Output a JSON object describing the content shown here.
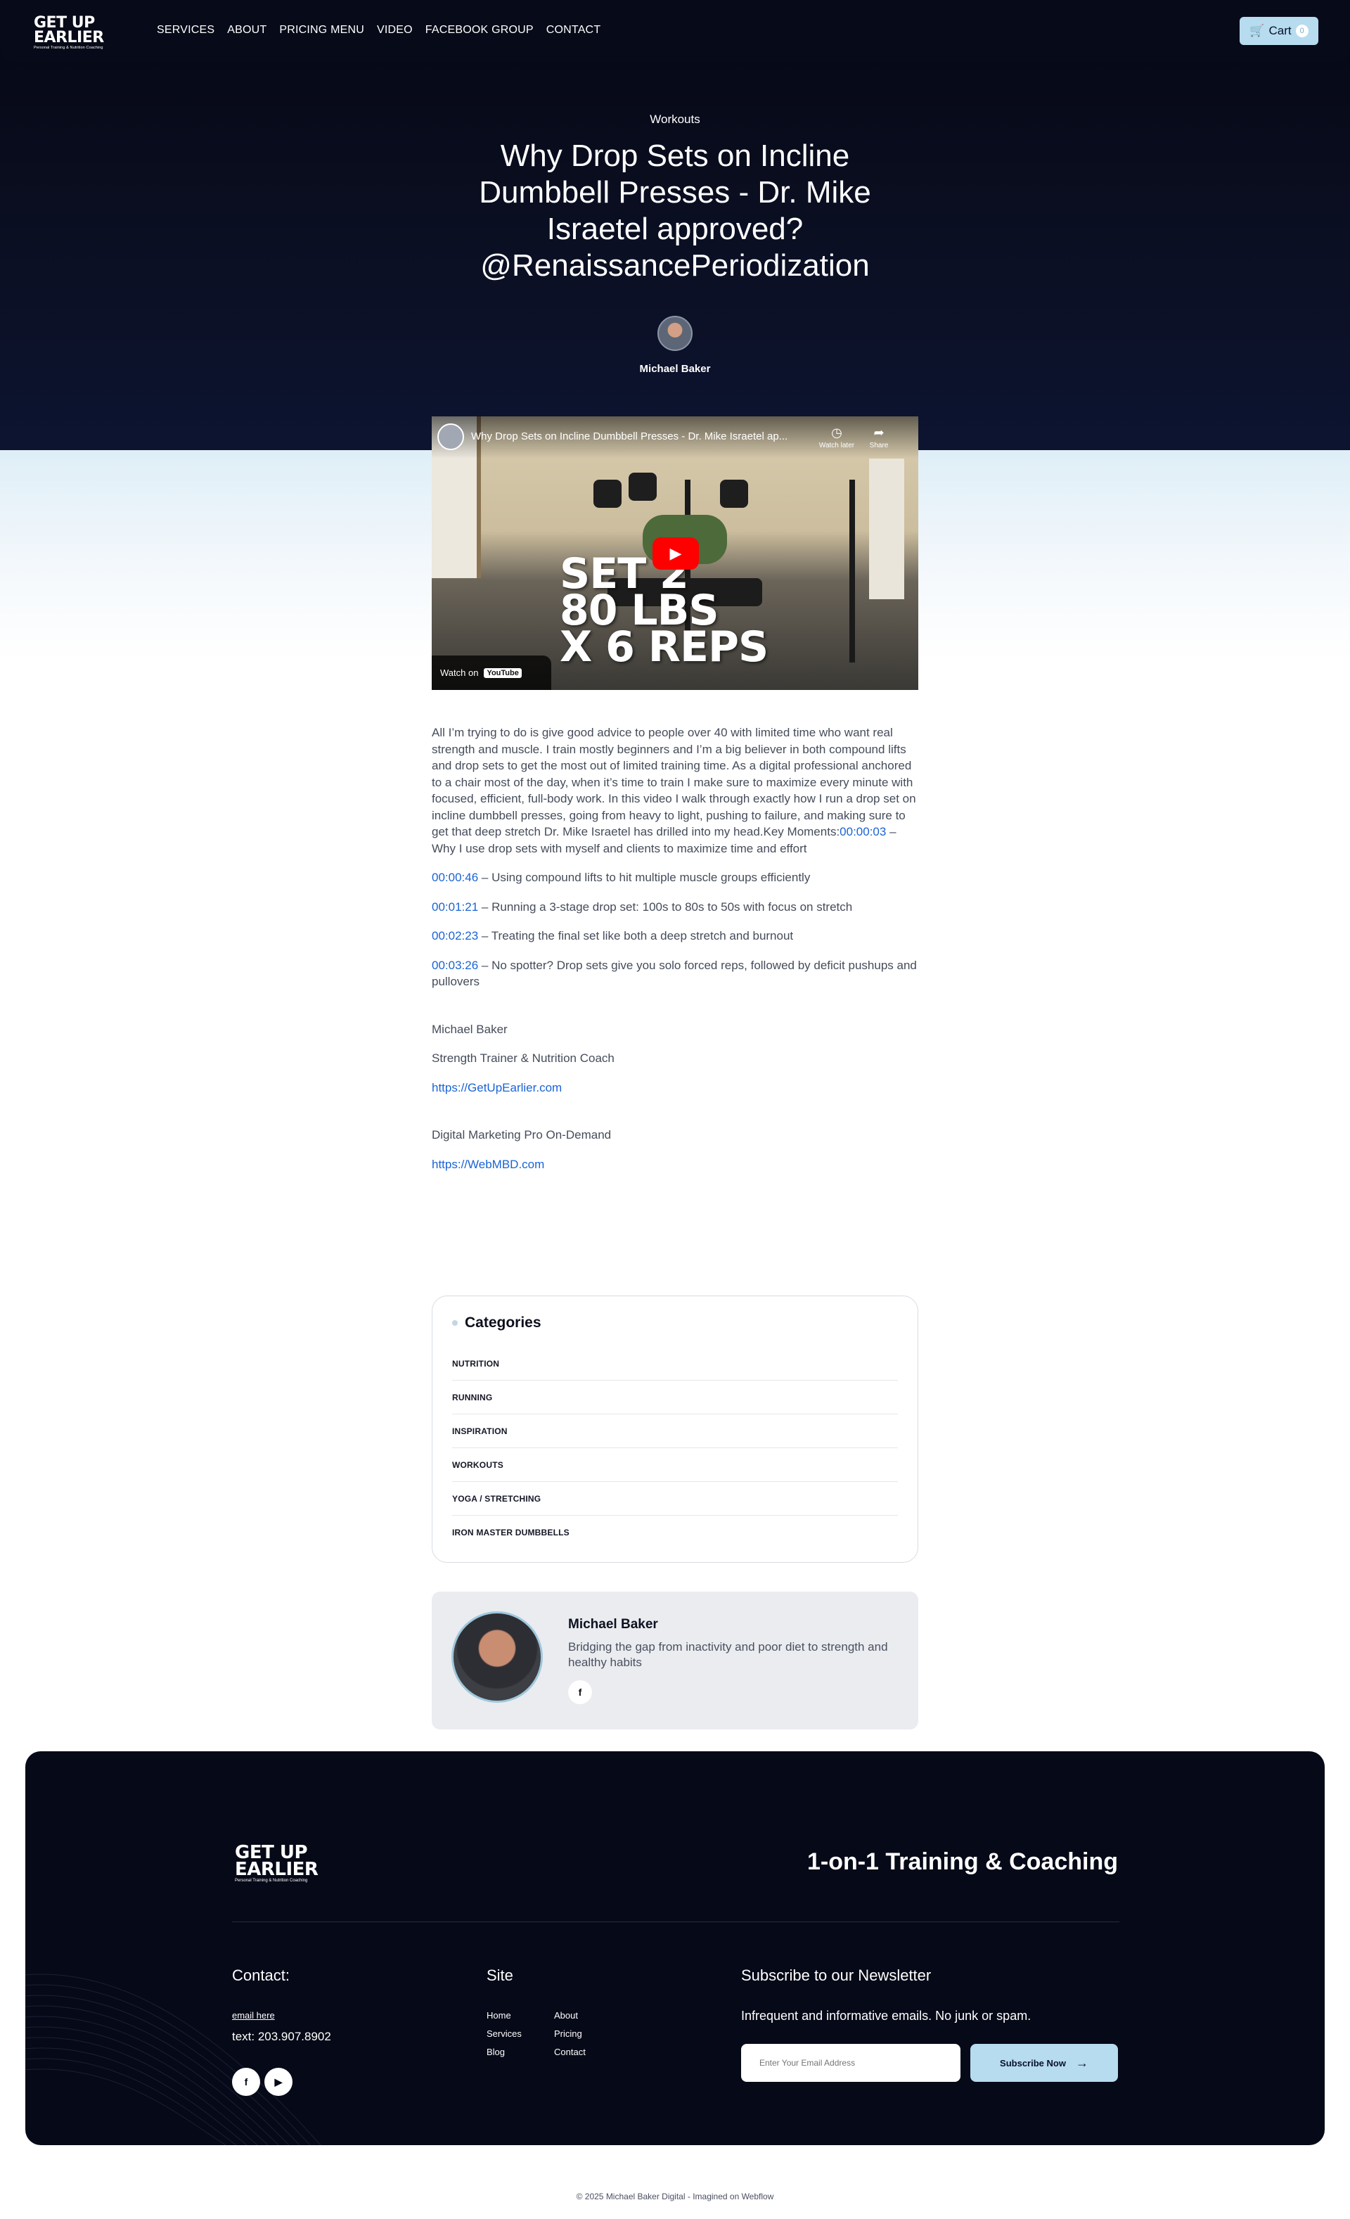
{
  "nav": {
    "logo_line1": "GET UP",
    "logo_line2": "EARLIER",
    "logo_tagline": "Personal Training & Nutrition Coaching",
    "links": [
      "SERVICES",
      "ABOUT",
      "PRICING MENU",
      "VIDEO",
      "FACEBOOK GROUP",
      "CONTACT"
    ],
    "cart_label": "Cart",
    "cart_count": "0"
  },
  "hero": {
    "category": "Workouts",
    "title": "Why Drop Sets on Incline Dumbbell Presses - Dr. Mike Israetel approved? @RenaissancePeriodization",
    "author": "Michael Baker"
  },
  "video": {
    "title": "Why Drop Sets on Incline Dumbbell Presses - Dr. Mike Israetel ap...",
    "watch_later": "Watch later",
    "share": "Share",
    "overlay_line1": "SET 2",
    "overlay_line2": "80 LBS",
    "overlay_line3": "X 6 REPS",
    "watch_on": "Watch on",
    "youtube": "YouTube"
  },
  "article": {
    "intro": "All I’m trying to do is give good advice to people over 40 with limited time who want real strength and muscle. I train mostly beginners and I’m a big believer in both compound lifts and drop sets to get the most out of limited training time. As a digital professional anchored to a chair most of the day, when it’s time to train I make sure to maximize every minute with focused, efficient, full-body work. In this video I walk through exactly how I run a drop set on incline dumbbell presses, going from heavy to light, pushing to failure, and making sure to get that deep stretch Dr. Mike Israetel has drilled into my head.Key Moments:",
    "moments": [
      {
        "time": "00:00:03",
        "text": " – Why I use drop sets with myself and clients to maximize time and effort"
      },
      {
        "time": "00:00:46",
        "text": " – Using compound lifts to hit multiple muscle groups efficiently"
      },
      {
        "time": "00:01:21",
        "text": " – Running a 3-stage drop set: 100s to 80s to 50s with focus on stretch"
      },
      {
        "time": "00:02:23",
        "text": " – Treating the final set like both a deep stretch and burnout"
      },
      {
        "time": "00:03:26",
        "text": " – No spotter? Drop sets give you solo forced reps, followed by deficit pushups and pullovers"
      }
    ],
    "sig_name": "Michael Baker",
    "sig_role": "Strength Trainer & Nutrition Coach",
    "sig_url": "https://GetUpEarlier.com",
    "sig2_company": "Digital Marketing Pro On-Demand",
    "sig2_url": "https://WebMBD.com"
  },
  "categories": {
    "title": "Categories",
    "items": [
      "NUTRITION",
      "RUNNING",
      "INSPIRATION",
      "WORKOUTS",
      "YOGA / STRETCHING",
      "IRON MASTER DUMBBELLS"
    ]
  },
  "author_card": {
    "name": "Michael Baker",
    "bio": "Bridging the gap from inactivity and poor diet to strength and healthy habits",
    "social_icon": "facebook-icon"
  },
  "footer": {
    "logo_line1": "GET UP",
    "logo_line2": "EARLIER",
    "logo_tagline": "Personal Training & Nutrition Coaching",
    "tagline": "1-on-1 Training & Coaching",
    "contact_heading": "Contact:",
    "email_label": "email here",
    "phone": "text: 203.907.8902",
    "site_heading": "Site",
    "site_links": [
      "Home",
      "About",
      "Services",
      "Pricing",
      "Blog",
      "Contact"
    ],
    "subscribe_heading": "Subscribe to our Newsletter",
    "subscribe_text": "Infrequent and informative emails. No junk or spam.",
    "email_placeholder": "Enter Your Email Address",
    "subscribe_button": "Subscribe Now",
    "copyright": "© 2025 Michael Baker Digital - Imagined on Webflow"
  },
  "colors": {
    "dark_navy": "#060917",
    "accent_light_blue": "#b7dbef",
    "link_blue": "#1a63d6"
  }
}
